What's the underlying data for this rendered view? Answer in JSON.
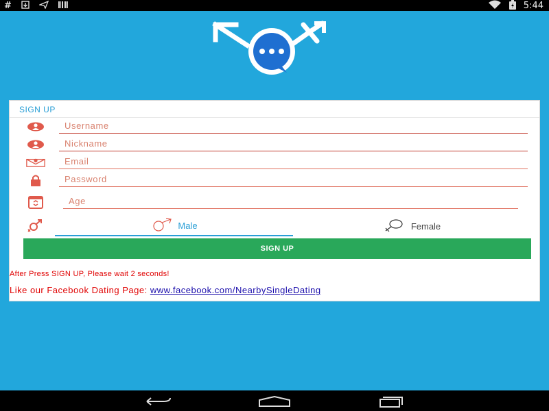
{
  "status_bar": {
    "left_icons": [
      "hash-icon",
      "download-icon",
      "send-icon",
      "barcode-icon"
    ],
    "hash_glyph": "#",
    "time": "5:44"
  },
  "form": {
    "title": "SIGN UP",
    "fields": [
      {
        "name": "username",
        "placeholder": "Username",
        "icon": "user-icon"
      },
      {
        "name": "nickname",
        "placeholder": "Nickname",
        "icon": "user-icon"
      },
      {
        "name": "email",
        "placeholder": "Email",
        "icon": "mail-icon"
      },
      {
        "name": "password",
        "placeholder": "Password",
        "icon": "lock-icon"
      },
      {
        "name": "age",
        "placeholder": "Age",
        "icon": "calendar-icon"
      }
    ],
    "gender": {
      "icon": "gender-icon",
      "options": [
        {
          "label": "Male",
          "selected": true
        },
        {
          "label": "Female",
          "selected": false
        }
      ]
    },
    "submit_label": "SIGN UP",
    "note": "After Press SIGN UP, Please wait 2 seconds!",
    "facebook_text": "Like our Facebook Dating Page: ",
    "facebook_link": "www.facebook.com/NearbySingleDating"
  },
  "colors": {
    "background": "#22a7dc",
    "accent": "#2a9fd6",
    "button": "#29a85a",
    "icon_red": "#e05a4c",
    "note_red": "#e00000"
  },
  "nav_bar": {
    "buttons": [
      "back-icon",
      "home-icon",
      "recents-icon"
    ]
  }
}
